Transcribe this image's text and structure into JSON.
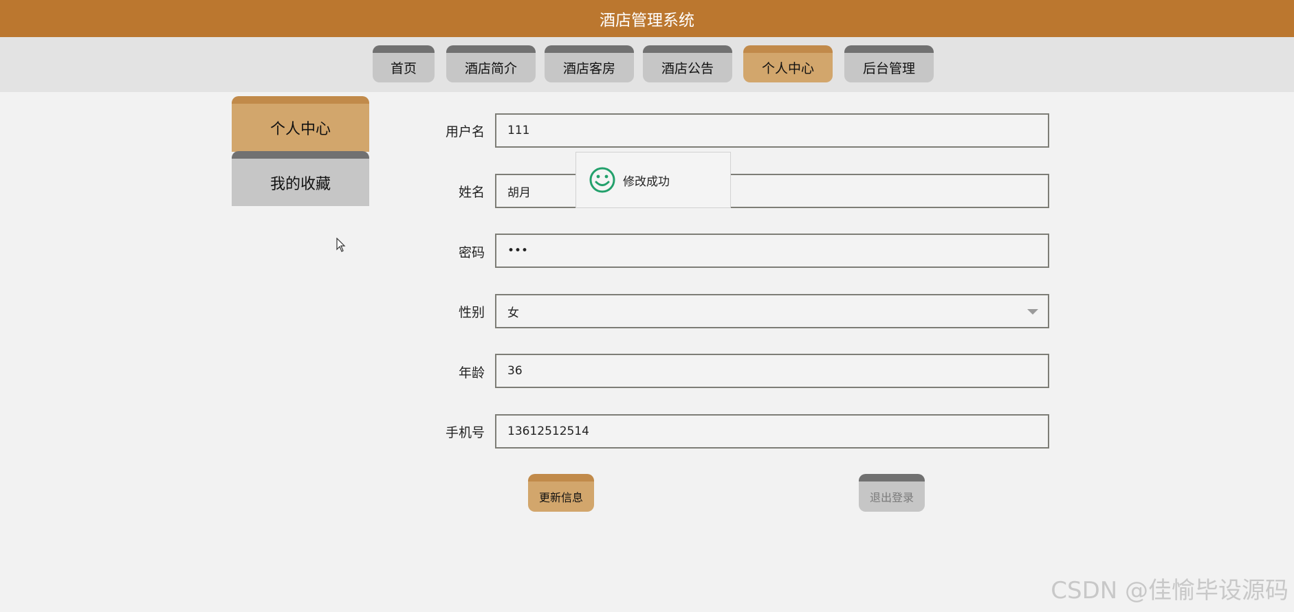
{
  "app": {
    "title": "酒店管理系统"
  },
  "nav": {
    "tabs": [
      {
        "label": "首页"
      },
      {
        "label": "酒店简介"
      },
      {
        "label": "酒店客房"
      },
      {
        "label": "酒店公告"
      },
      {
        "label": "个人中心",
        "active": true
      },
      {
        "label": "后台管理"
      }
    ]
  },
  "sidebar": {
    "items": [
      {
        "label": "个人中心",
        "active": true
      },
      {
        "label": "我的收藏"
      }
    ]
  },
  "form": {
    "username": {
      "label": "用户名",
      "value": "111"
    },
    "name": {
      "label": "姓名",
      "value": "胡月"
    },
    "password": {
      "label": "密码",
      "value": "•••"
    },
    "gender": {
      "label": "性别",
      "value": "女"
    },
    "age": {
      "label": "年龄",
      "value": "36"
    },
    "phone": {
      "label": "手机号",
      "value": "13612512514"
    }
  },
  "buttons": {
    "update": "更新信息",
    "logout": "退出登录"
  },
  "toast": {
    "message": "修改成功",
    "icon": "smile-icon"
  },
  "watermark": "CSDN @佳愉毕设源码",
  "colors": {
    "brand": "#bb772f",
    "active_tab": "#d2a66c",
    "inactive_tab": "#c6c6c6",
    "tab_top_border": "#717171",
    "success_icon": "#22a06b"
  }
}
